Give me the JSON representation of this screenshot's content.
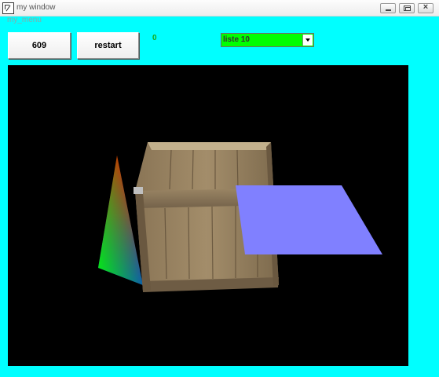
{
  "window": {
    "title": "my window"
  },
  "menu": {
    "items": [
      {
        "label": "my_menu"
      }
    ]
  },
  "toolbar": {
    "counter_label": "609",
    "restart_label": "restart",
    "score_value": "0",
    "list_select": {
      "value": "liste 10"
    }
  },
  "colors": {
    "background": "#00ffff",
    "select_bg": "#00ff00",
    "plane": "#8080ff",
    "score": "#17a817"
  }
}
